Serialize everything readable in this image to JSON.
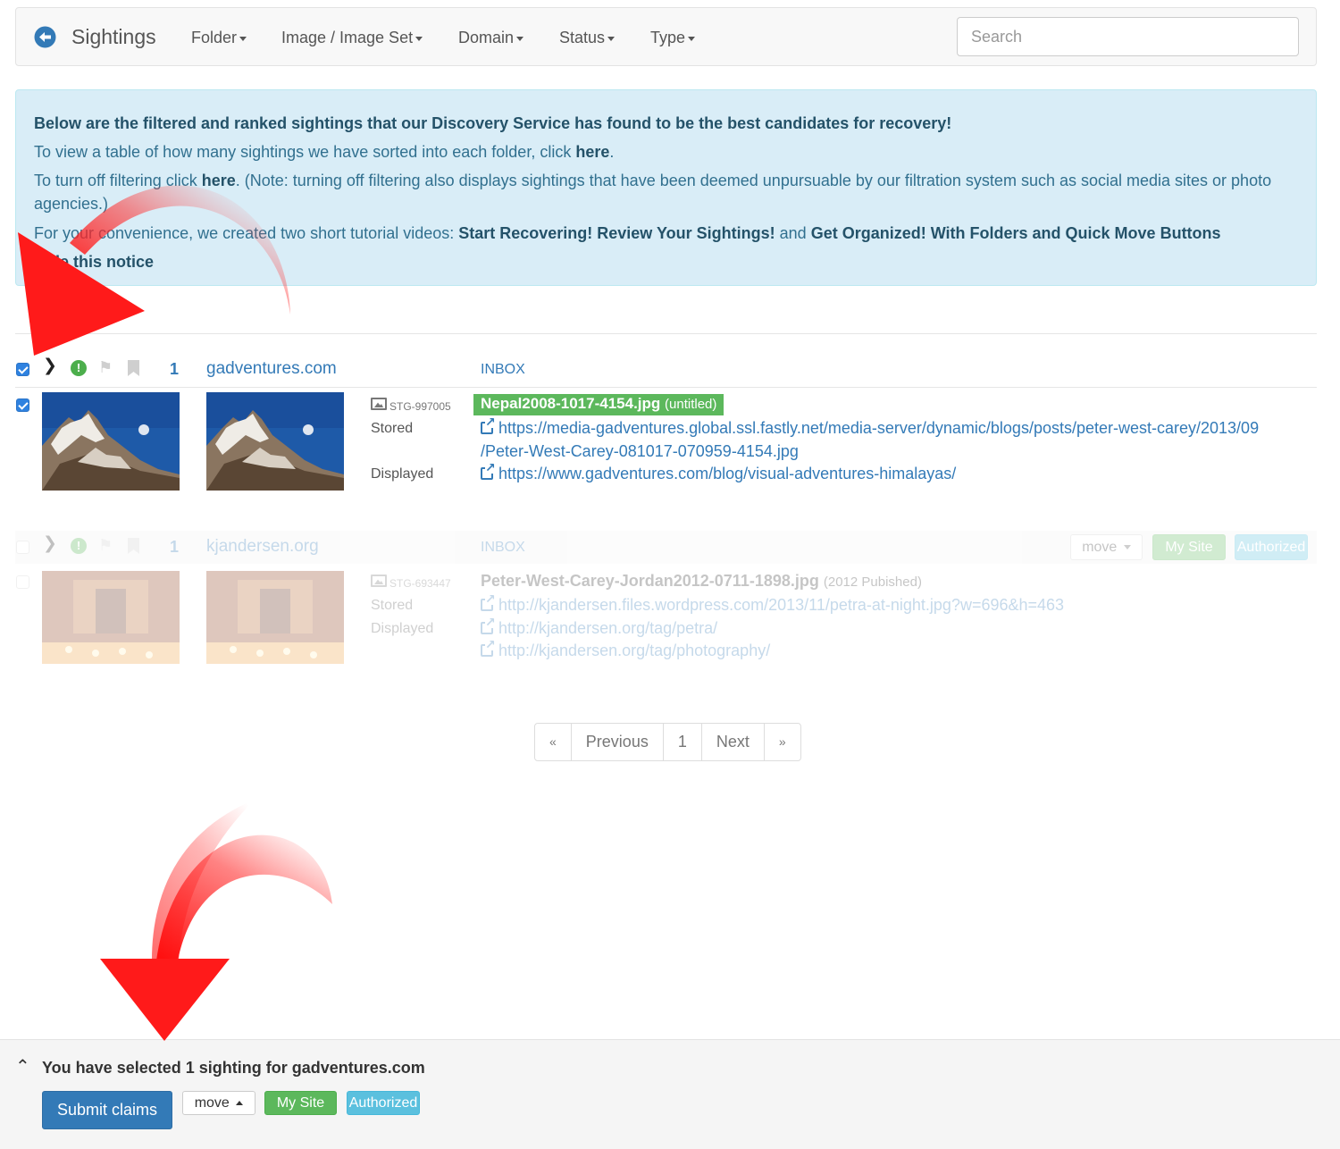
{
  "navbar": {
    "brand": "Sightings",
    "menus": [
      "Folder",
      "Image / Image Set",
      "Domain",
      "Status",
      "Type"
    ],
    "search_placeholder": "Search"
  },
  "notice": {
    "headline": "Below are the filtered and ranked sightings that our Discovery Service has found to be the best candidates for recovery!",
    "line2_pre": "To view a table of how many sightings we have sorted into each folder, click ",
    "line2_link": "here",
    "line2_post": ".",
    "line3_pre": "To turn off filtering click ",
    "line3_link": "here",
    "line3_post": ". (Note: turning off filtering also displays sightings that have been deemed unpursuable by our filtration system such as social media sites or photo agencies.)",
    "line4_pre": "For your convenience, we created two short tutorial videos: ",
    "video1": "Start Recovering! Review Your Sightings!",
    "line4_mid": " and ",
    "video2": "Get Organized! With Folders and Quick Move Buttons",
    "hide": "Hide this notice"
  },
  "sightings": [
    {
      "count": "1",
      "domain": "gadventures.com",
      "folder": "INBOX",
      "stg_id": "STG-997005",
      "stored_label": "Stored",
      "displayed_label": "Displayed",
      "filename": "Nepal2008-1017-4154.jpg",
      "file_note": "(untitled)",
      "links": [
        "https://media-gadventures.global.ssl.fastly.net/media-server/dynamic/blogs/posts/peter-west-carey/2013/09",
        "/Peter-West-Carey-081017-070959-4154.jpg",
        "https://www.gadventures.com/blog/visual-adventures-himalayas/"
      ]
    },
    {
      "count": "1",
      "domain": "kjandersen.org",
      "folder": "INBOX",
      "move_label": "move",
      "my_site_label": "My Site",
      "authorized_label": "Authorized",
      "stg_id": "STG-693447",
      "stored_label": "Stored",
      "displayed_label": "Displayed",
      "filename": "Peter-West-Carey-Jordan2012-0711-1898.jpg",
      "file_note": "(2012 Pubished)",
      "links": [
        "http://kjandersen.files.wordpress.com/2013/11/petra-at-night.jpg?w=696&h=463",
        "http://kjandersen.org/tag/petra/",
        "http://kjandersen.org/tag/photography/"
      ]
    }
  ],
  "pagination": {
    "first": "«",
    "previous": "Previous",
    "page": "1",
    "next": "Next",
    "last": "»"
  },
  "footer": {
    "selection_text": "You have selected 1 sighting for gadventures.com",
    "submit_label": "Submit claims",
    "move_label": "move",
    "my_site_label": "My Site",
    "authorized_label": "Authorized"
  },
  "colors": {
    "accent": "#337ab7",
    "success": "#5cb85c",
    "info": "#5bc0de",
    "notice_bg": "#d9edf7",
    "arrow": "#ff2020"
  }
}
